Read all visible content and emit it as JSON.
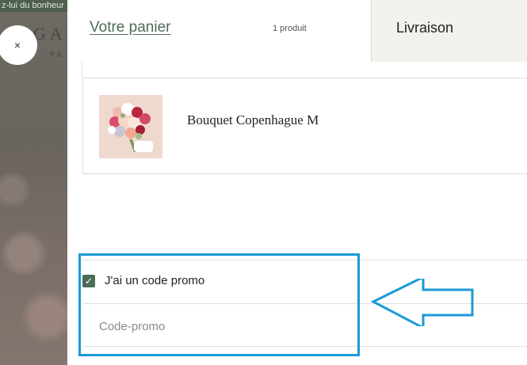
{
  "background": {
    "banner_text": "z-lui du bonheur",
    "logo_text": "GA",
    "logo_sub": "PA"
  },
  "close_button": {
    "label": "×",
    "icon": "close-icon"
  },
  "cart": {
    "tab_cart_label": "Votre panier",
    "item_count": "1 produit",
    "tab_delivery_label": "Livraison",
    "items": [
      {
        "name": "Bouquet Copenhague M",
        "image": "bouquet-photo"
      }
    ],
    "promo": {
      "checkbox_label": "J'ai un code promo",
      "checked": true,
      "input_placeholder": "Code-promo",
      "input_value": ""
    }
  },
  "colors": {
    "accent_green": "#4f6b58",
    "annotation_blue": "#1b9ad6",
    "delivery_tab_bg": "#f3f1ec"
  }
}
